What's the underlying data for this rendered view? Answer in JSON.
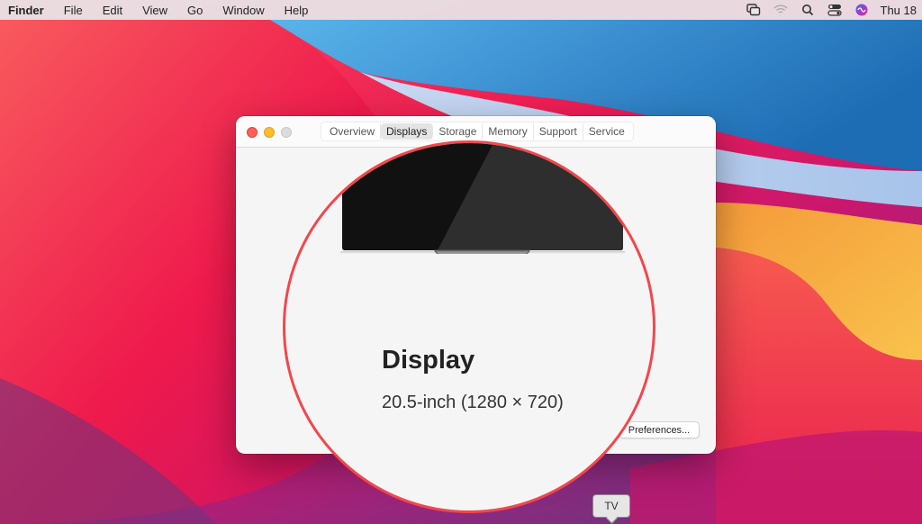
{
  "menubar": {
    "apple_menu": "Finder",
    "items": [
      "File",
      "Edit",
      "View",
      "Go",
      "Window",
      "Help"
    ],
    "status_icons": [
      "screen-mirroring-icon",
      "wifi-icon",
      "spotlight-search-icon",
      "control-center-icon",
      "siri-icon"
    ],
    "clock": "Thu 18"
  },
  "window": {
    "tabs": [
      {
        "label": "Overview",
        "active": false
      },
      {
        "label": "Displays",
        "active": true
      },
      {
        "label": "Storage",
        "active": false
      },
      {
        "label": "Memory",
        "active": false
      },
      {
        "label": "Support",
        "active": false
      },
      {
        "label": "Service",
        "active": false
      }
    ],
    "preferences_button": "Preferences..."
  },
  "magnifier": {
    "title": "Display",
    "subtitle": "20.5-inch (1280 × 720)",
    "highlight_color": "#f2474c"
  },
  "dock_tooltip": "TV"
}
